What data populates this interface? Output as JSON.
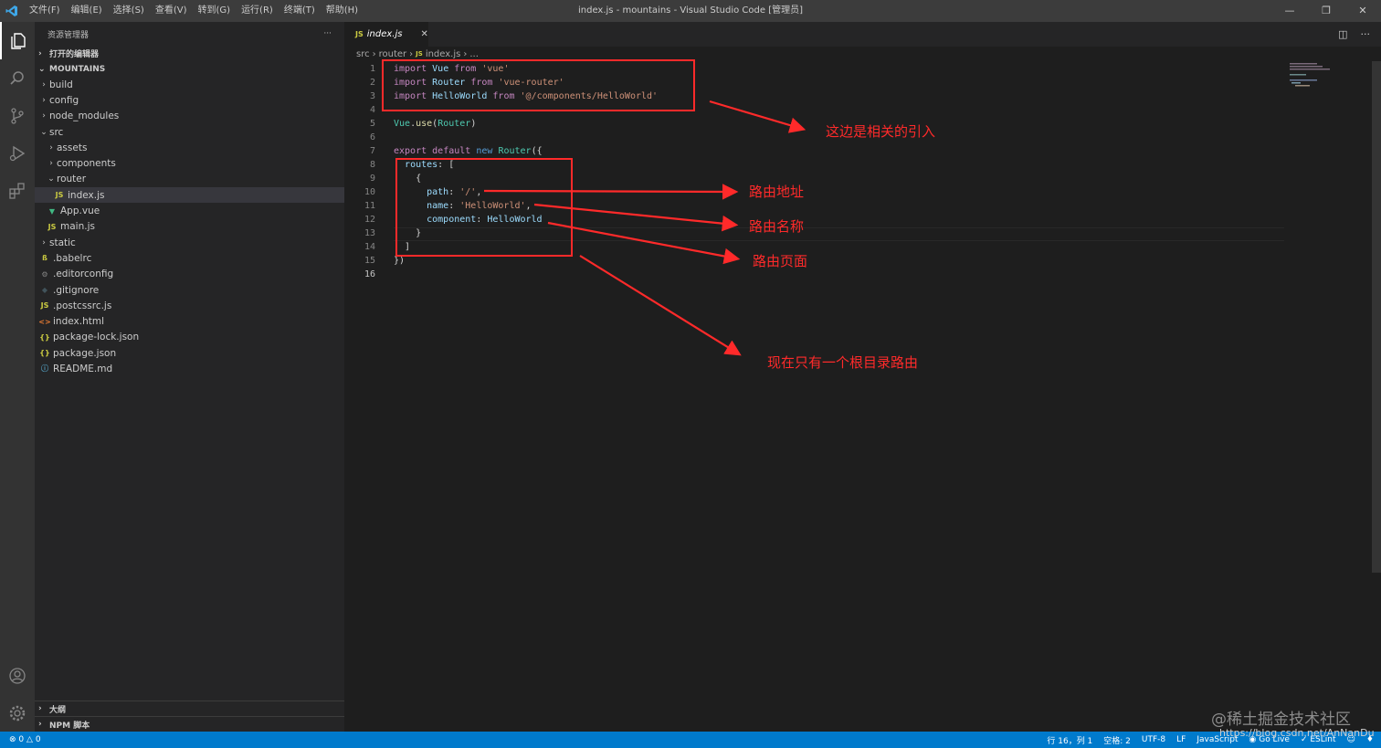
{
  "window": {
    "title": "index.js - mountains - Visual Studio Code [管理员]",
    "menu": [
      "文件(F)",
      "编辑(E)",
      "选择(S)",
      "查看(V)",
      "转到(G)",
      "运行(R)",
      "终端(T)",
      "帮助(H)"
    ]
  },
  "sidebar": {
    "header": "资源管理器",
    "more": "···",
    "open_editors": "打开的编辑器",
    "project": "MOUNTAINS",
    "tree": [
      {
        "label": "build",
        "type": "folder",
        "depth": 1,
        "expanded": false
      },
      {
        "label": "config",
        "type": "folder",
        "depth": 1,
        "expanded": false
      },
      {
        "label": "node_modules",
        "type": "folder",
        "depth": 1,
        "expanded": false
      },
      {
        "label": "src",
        "type": "folder",
        "depth": 1,
        "expanded": true
      },
      {
        "label": "assets",
        "type": "folder",
        "depth": 2,
        "expanded": false
      },
      {
        "label": "components",
        "type": "folder",
        "depth": 2,
        "expanded": false
      },
      {
        "label": "router",
        "type": "folder",
        "depth": 2,
        "expanded": true
      },
      {
        "label": "index.js",
        "type": "js",
        "depth": 3,
        "selected": true
      },
      {
        "label": "App.vue",
        "type": "vue",
        "depth": 2
      },
      {
        "label": "main.js",
        "type": "js",
        "depth": 2
      },
      {
        "label": "static",
        "type": "folder",
        "depth": 1,
        "expanded": false
      },
      {
        "label": ".babelrc",
        "type": "babel",
        "depth": 1
      },
      {
        "label": ".editorconfig",
        "type": "config",
        "depth": 1
      },
      {
        "label": ".gitignore",
        "type": "git",
        "depth": 1
      },
      {
        "label": ".postcssrc.js",
        "type": "js",
        "depth": 1
      },
      {
        "label": "index.html",
        "type": "html",
        "depth": 1
      },
      {
        "label": "package-lock.json",
        "type": "json",
        "depth": 1
      },
      {
        "label": "package.json",
        "type": "json",
        "depth": 1
      },
      {
        "label": "README.md",
        "type": "md",
        "depth": 1
      }
    ],
    "outline": "大纲",
    "npm": "NPM 脚本"
  },
  "editor": {
    "tab_label": "index.js",
    "tab_icon": "JS",
    "breadcrumb": [
      "src",
      "router",
      "index.js",
      "..."
    ],
    "lines": [
      [
        [
          "kw",
          "import"
        ],
        [
          "plain",
          " "
        ],
        [
          "id",
          "Vue"
        ],
        [
          "plain",
          " "
        ],
        [
          "kw",
          "from"
        ],
        [
          "plain",
          " "
        ],
        [
          "str",
          "'vue'"
        ]
      ],
      [
        [
          "kw",
          "import"
        ],
        [
          "plain",
          " "
        ],
        [
          "id",
          "Router"
        ],
        [
          "plain",
          " "
        ],
        [
          "kw",
          "from"
        ],
        [
          "plain",
          " "
        ],
        [
          "str",
          "'vue-router'"
        ]
      ],
      [
        [
          "kw",
          "import"
        ],
        [
          "plain",
          " "
        ],
        [
          "id",
          "HelloWorld"
        ],
        [
          "plain",
          " "
        ],
        [
          "kw",
          "from"
        ],
        [
          "plain",
          " "
        ],
        [
          "str",
          "'@/components/HelloWorld'"
        ]
      ],
      [],
      [
        [
          "cls",
          "Vue"
        ],
        [
          "plain",
          "."
        ],
        [
          "fn",
          "use"
        ],
        [
          "plain",
          "("
        ],
        [
          "cls",
          "Router"
        ],
        [
          "plain",
          ")"
        ]
      ],
      [],
      [
        [
          "kw",
          "export"
        ],
        [
          "plain",
          " "
        ],
        [
          "kw",
          "default"
        ],
        [
          "plain",
          " "
        ],
        [
          "blue",
          "new"
        ],
        [
          "plain",
          " "
        ],
        [
          "cls",
          "Router"
        ],
        [
          "plain",
          "({"
        ]
      ],
      [
        [
          "plain",
          "  "
        ],
        [
          "id",
          "routes"
        ],
        [
          "plain",
          ": ["
        ]
      ],
      [
        [
          "plain",
          "    {"
        ]
      ],
      [
        [
          "plain",
          "      "
        ],
        [
          "id",
          "path"
        ],
        [
          "plain",
          ": "
        ],
        [
          "str",
          "'/'"
        ],
        [
          "plain",
          ","
        ]
      ],
      [
        [
          "plain",
          "      "
        ],
        [
          "id",
          "name"
        ],
        [
          "plain",
          ": "
        ],
        [
          "str",
          "'HelloWorld'"
        ],
        [
          "plain",
          ","
        ]
      ],
      [
        [
          "plain",
          "      "
        ],
        [
          "id",
          "component"
        ],
        [
          "plain",
          ": "
        ],
        [
          "id",
          "HelloWorld"
        ]
      ],
      [
        [
          "plain",
          "    }"
        ]
      ],
      [
        [
          "plain",
          "  ]"
        ]
      ],
      [
        [
          "plain",
          "})"
        ]
      ],
      []
    ],
    "current_line": 16
  },
  "annotations": {
    "imports": "这边是相关的引入",
    "path": "路由地址",
    "name": "路由名称",
    "page": "路由页面",
    "root": "现在只有一个根目录路由",
    "color": "#ff2a2a"
  },
  "statusbar": {
    "errors": "0",
    "warnings": "0",
    "position": "行 16，列 1",
    "spaces": "空格: 2",
    "encoding": "UTF-8",
    "eol": "LF",
    "language": "JavaScript",
    "golive": "Go Live",
    "eslint": "ESLint"
  },
  "watermark": {
    "line1": "@稀土掘金技术社区",
    "line2": "https://blog.csdn.net/AnNanDu"
  }
}
